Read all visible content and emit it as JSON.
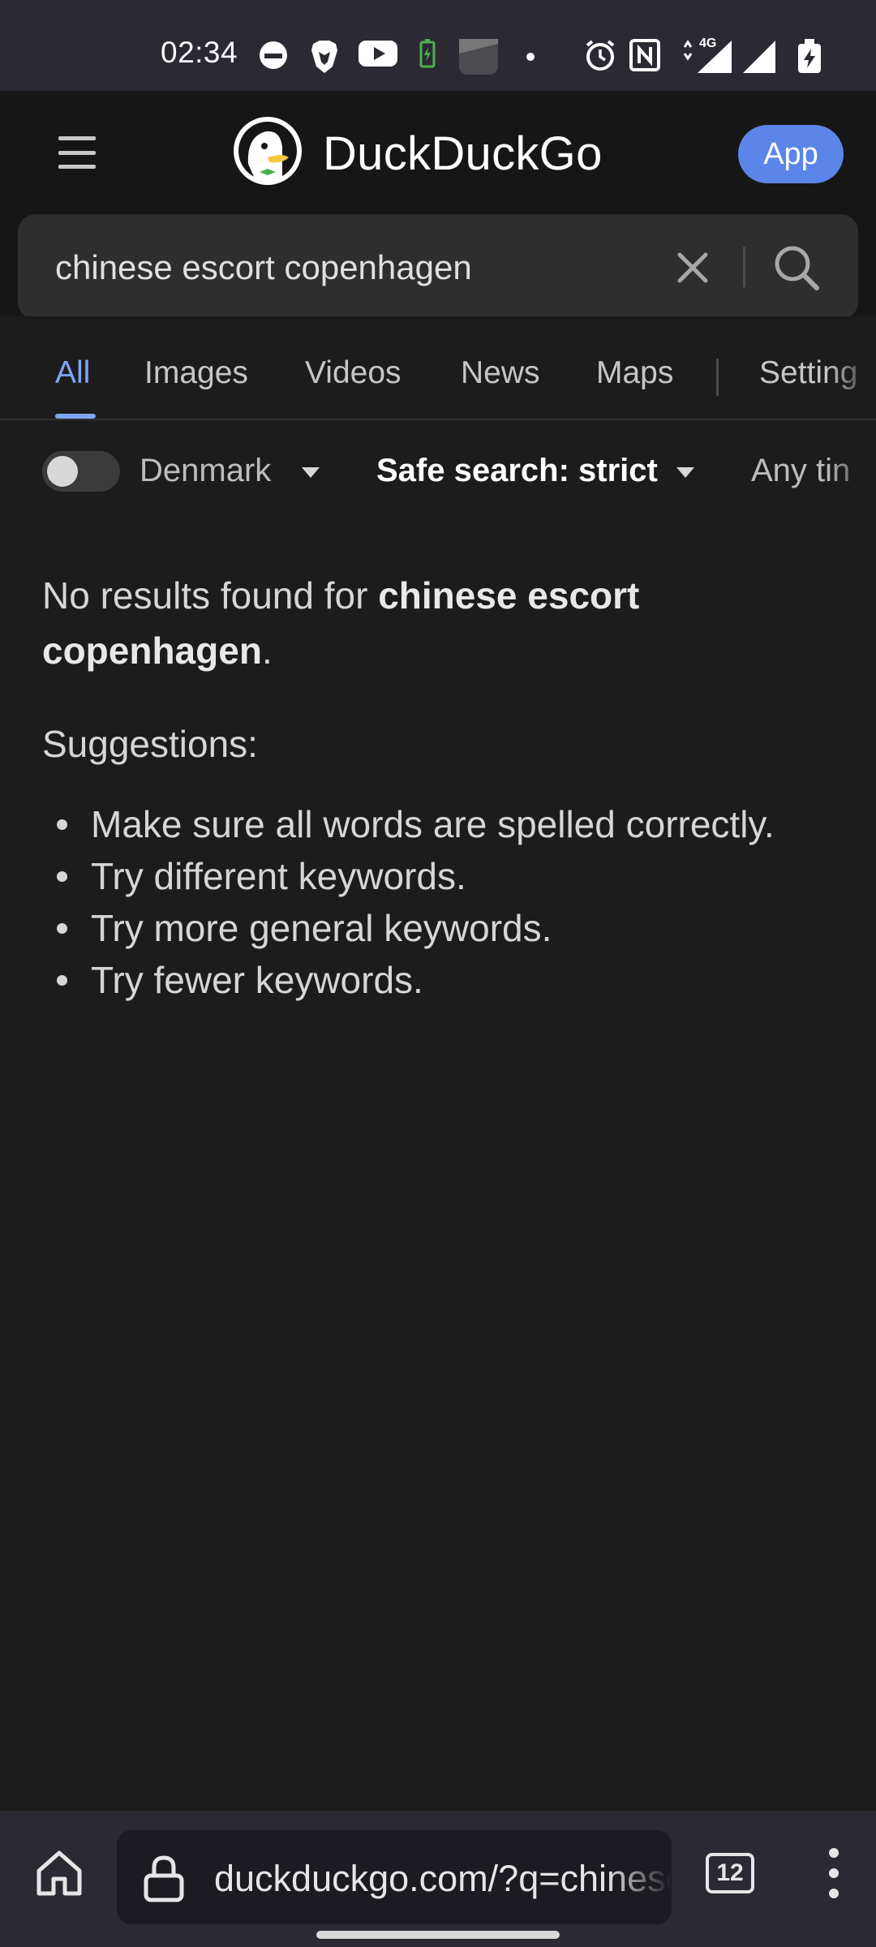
{
  "status_bar": {
    "time": "02:34",
    "icons": [
      "incognito-icon",
      "brave-lion-icon",
      "youtube-icon",
      "battery-saver-icon",
      "app-icon",
      "dot-icon",
      "alarm-icon",
      "nfc-icon",
      "signal-4g-icon",
      "signal-icon",
      "battery-charging-icon"
    ],
    "network_label": "4G"
  },
  "header": {
    "menu_icon": "hamburger-menu-icon",
    "brand": "DuckDuckGo",
    "app_button": "App"
  },
  "search": {
    "query": "chinese escort copenhagen"
  },
  "tabs": [
    {
      "label": "All",
      "active": true
    },
    {
      "label": "Images"
    },
    {
      "label": "Videos"
    },
    {
      "label": "News"
    },
    {
      "label": "Maps"
    },
    {
      "label": "Setting"
    }
  ],
  "filters": {
    "region": "Denmark",
    "safe_search": "Safe search: strict",
    "time": "Any tin"
  },
  "results": {
    "no_results_prefix": "No results found for ",
    "query_bold": "chinese escort copenhagen",
    "suffix": ".",
    "suggestions_title": "Suggestions:",
    "suggestions": [
      "Make sure all words are spelled correctly.",
      "Try different keywords.",
      "Try more general keywords.",
      "Try fewer keywords."
    ]
  },
  "bottom_bar": {
    "url": "duckduckgo.com/?q=chinese",
    "tab_count": "12"
  },
  "colors": {
    "background": "#1c1c1c",
    "accent": "#7ea6f2",
    "app_button": "#5b85e8"
  }
}
